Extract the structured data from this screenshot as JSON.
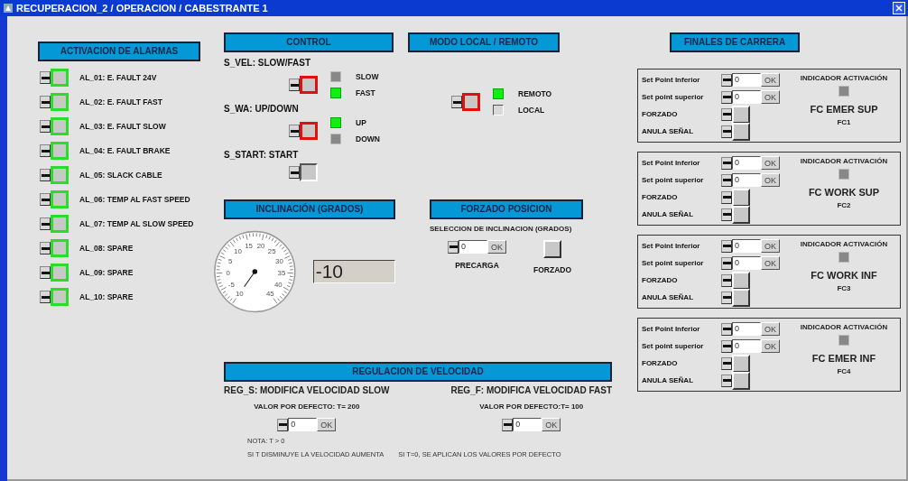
{
  "window": {
    "title": "RECUPERACION_2 / OPERACION / CABESTRANTE 1"
  },
  "alarms": {
    "title": "ACTIVACION DE ALARMAS",
    "items": [
      {
        "label": "AL_01: E. FAULT 24V"
      },
      {
        "label": "AL_02: E. FAULT FAST"
      },
      {
        "label": "AL_03: E. FAULT SLOW"
      },
      {
        "label": "AL_04: E. FAULT BRAKE"
      },
      {
        "label": "AL_05: SLACK CABLE"
      },
      {
        "label": "AL_06: TEMP AL FAST SPEED"
      },
      {
        "label": "AL_07: TEMP AL SLOW SPEED"
      },
      {
        "label": "AL_08: SPARE"
      },
      {
        "label": "AL_09: SPARE"
      },
      {
        "label": "AL_10: SPARE"
      }
    ]
  },
  "control": {
    "title": "CONTROL",
    "switches": [
      {
        "label": "S_VEL: SLOW/FAST",
        "active": true,
        "indicators": [
          {
            "label": "SLOW",
            "on": false
          },
          {
            "label": "FAST",
            "on": true
          }
        ]
      },
      {
        "label": "S_WA: UP/DOWN",
        "active": true,
        "indicators": [
          {
            "label": "UP",
            "on": true
          },
          {
            "label": "DOWN",
            "on": false
          }
        ]
      },
      {
        "label": "S_START: START",
        "active": false
      }
    ]
  },
  "mode": {
    "title": "MODO LOCAL / REMOTO",
    "active": true,
    "indicators": [
      {
        "label": "REMOTO",
        "on": true
      },
      {
        "label": "LOCAL",
        "on": false
      }
    ]
  },
  "inclination": {
    "title": "INCLINACIÓN (GRADOS)",
    "gauge": {
      "ticks": [
        "10",
        "-5",
        "0",
        "5",
        "10",
        "15",
        "20",
        "25",
        "30",
        "35",
        "40",
        "45"
      ]
    },
    "reading": "-10"
  },
  "forced_position": {
    "title": "FORZADO POSICION",
    "subtitle": "SELECCION DE INCLINACION (GRADOS)",
    "preload": {
      "value": "0",
      "ok": "OK",
      "label": "PRECARGA"
    },
    "forced": {
      "label": "FORZADO"
    }
  },
  "speed": {
    "title": "REGULACION DE VELOCIDAD",
    "columns": [
      {
        "heading": "REG_S: MODIFICA VELOCIDAD SLOW",
        "default": "VALOR POR DEFECTO: T= 200",
        "value": "0",
        "ok": "OK",
        "note": "SI T DISMINUYE LA VELOCIDAD AUMENTA"
      },
      {
        "heading": "REG_F: MODIFICA VELOCIDAD FAST",
        "default": "VALOR POR DEFECTO:T= 100",
        "value": "0",
        "ok": "OK",
        "note": "SI T=0, SE APLICAN LOS VALORES POR DEFECTO"
      }
    ],
    "note": "NOTA: T > 0"
  },
  "limits": {
    "title": "FINALES DE CARRERA",
    "panels": [
      {
        "setpoints": [
          {
            "label": "Set Point Inferior",
            "value": "0",
            "ok": "OK"
          },
          {
            "label": "Set point superior",
            "value": "0",
            "ok": "OK"
          }
        ],
        "forced": "FORZADO",
        "cancel": "ANULA SEÑAL",
        "indicator_title": "INDICADOR ACTIVACIÓN",
        "indicator_on": false,
        "name": "FC EMER SUP",
        "code": "FC1"
      },
      {
        "setpoints": [
          {
            "label": "Set Point Inferior",
            "value": "0",
            "ok": "OK"
          },
          {
            "label": "Set point superior",
            "value": "0",
            "ok": "OK"
          }
        ],
        "forced": "FORZADO",
        "cancel": "ANULA SEÑAL",
        "indicator_title": "INDICADOR ACTIVACIÓN",
        "indicator_on": false,
        "name": "FC WORK SUP",
        "code": "FC2"
      },
      {
        "setpoints": [
          {
            "label": "Set Point Inferior",
            "value": "0",
            "ok": "OK"
          },
          {
            "label": "Set point superior",
            "value": "0",
            "ok": "OK"
          }
        ],
        "forced": "FORZADO",
        "cancel": "ANULA SEÑAL",
        "indicator_title": "INDICADOR ACTIVACIÓN",
        "indicator_on": false,
        "name": "FC WORK INF",
        "code": "FC3"
      },
      {
        "setpoints": [
          {
            "label": "Set Point Inferior",
            "value": "0",
            "ok": "OK"
          },
          {
            "label": "Set point superior",
            "value": "0",
            "ok": "OK"
          }
        ],
        "forced": "FORZADO",
        "cancel": "ANULA SEÑAL",
        "indicator_title": "INDICADOR ACTIVACIÓN",
        "indicator_on": false,
        "name": "FC EMER INF",
        "code": "FC4"
      }
    ]
  }
}
